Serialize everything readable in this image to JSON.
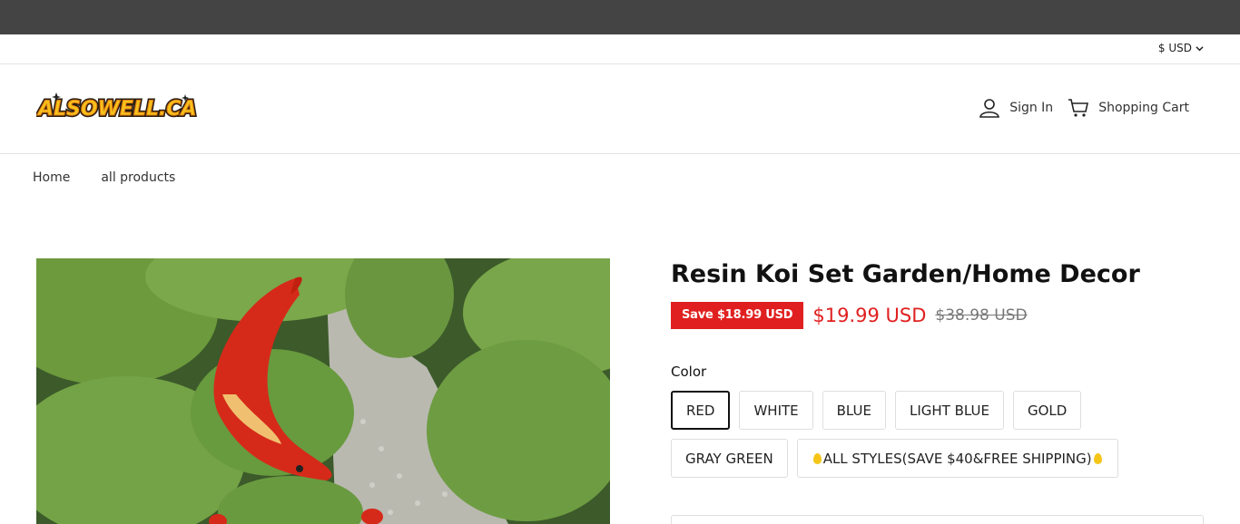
{
  "topbar": {
    "currency": "$ USD"
  },
  "header": {
    "logo_text": "ALSOWELL.CA",
    "sign_in": "Sign In",
    "cart": "Shopping Cart"
  },
  "breadcrumb": {
    "home": "Home",
    "all_products": "all products"
  },
  "product": {
    "title": "Resin Koi Set Garden/Home Decor",
    "save_badge": "Save $18.99 USD",
    "price": "$19.99 USD",
    "compare_price": "$38.98 USD",
    "color_label": "Color",
    "colors": {
      "red": "RED",
      "white": "WHITE",
      "blue": "BLUE",
      "light_blue": "LIGHT BLUE",
      "gold": "GOLD",
      "gray_green": "GRAY GREEN",
      "all_styles": "ALL STYLES(SAVE $40&FREE SHIPPING)"
    },
    "selected_color": "RED"
  },
  "colors": {
    "accent": "#e02020",
    "announcement_bar": "#444444"
  }
}
